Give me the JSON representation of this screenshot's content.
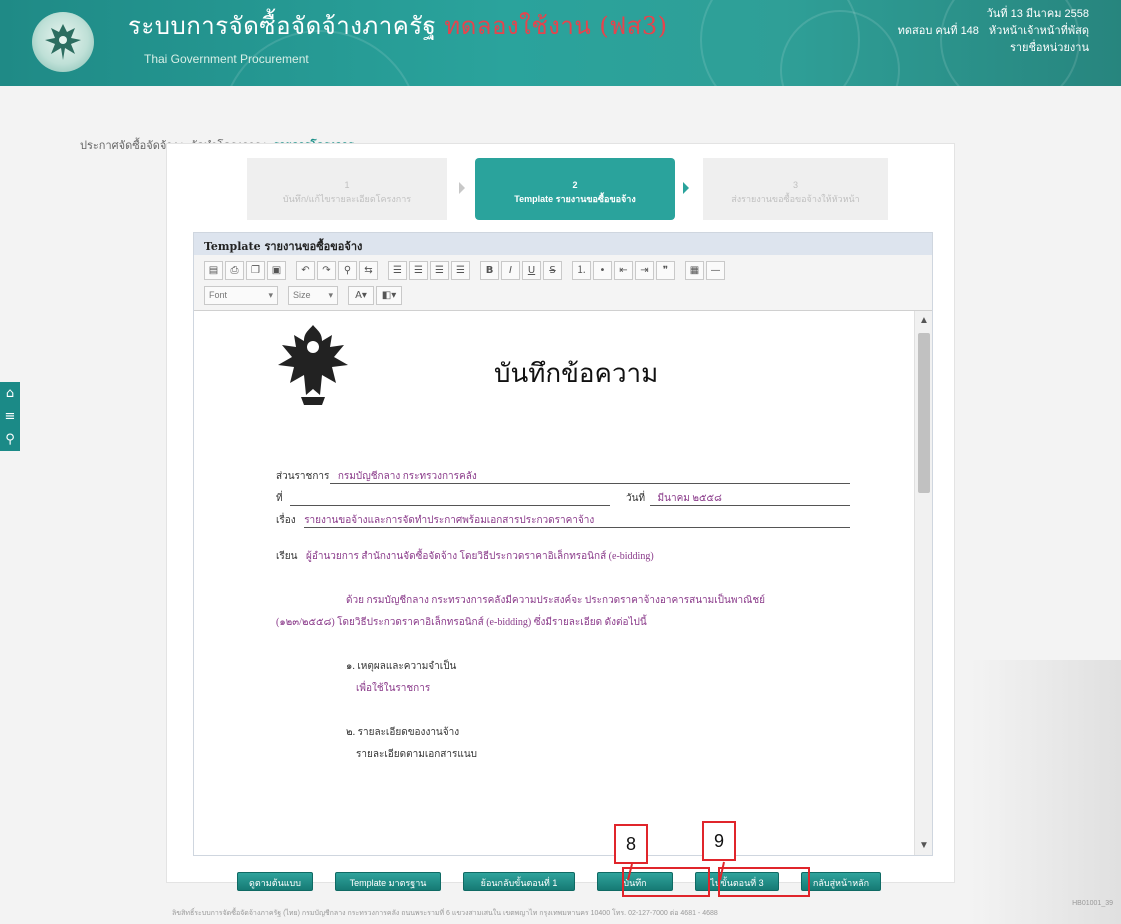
{
  "header": {
    "title": "ระบบการจัดซื้อจัดจ้างภาครัฐ",
    "title_tag": "ทดลองใช้งาน (ฟส3)",
    "subtitle": "Thai Government Procurement",
    "date": "วันที่ 13 มีนาคม 2558",
    "user_label": "ทดสอบ คนที่ 148",
    "role_label": "หัวหน้าเจ้าหน้าที่พัสดุ",
    "org_label": "รายชื่อหน่วยงาน"
  },
  "breadcrumb": {
    "item1": "ประกาศจัดซื้อจัดจ้าง",
    "sep1": ">",
    "item2": "จัดทำโครงการ",
    "sep2": ">",
    "item3": "รายการโครงการ"
  },
  "steps": [
    {
      "num": "1",
      "label": "บันทึก/แก้ไขรายละเอียดโครงการ"
    },
    {
      "num": "2",
      "label": "Template รายงานขอซื้อขอจ้าง"
    },
    {
      "num": "3",
      "label": "ส่งรายงานขอซื้อขอจ้างให้หัวหน้า"
    }
  ],
  "panel": {
    "title": "Template รายงานขอซื้อขอจ้าง"
  },
  "toolbar": {
    "font_label": "Font",
    "size_label": "Size"
  },
  "document": {
    "title": "บันทึกข้อความ",
    "agency_label": "ส่วนราชการ",
    "agency_value": "กรมบัญชีกลาง กระทรวงการคลัง",
    "ref_label": "ที่",
    "date_label": "วันที่",
    "date_value": "มีนาคม ๒๕๕๘",
    "subject_label": "เรื่อง",
    "subject_value": "รายงานขอจ้างและการจัดทำประกาศพร้อมเอกสารประกวดราคาจ้าง",
    "to_label": "เรียน",
    "to_value": "ผู้อำนวยการ สำนักงานจัดซื้อจัดจ้าง โดยวิธีประกวดราคาอิเล็กทรอนิกส์ (e-bidding)",
    "para1_line1": "ด้วย กรมบัญชีกลาง กระทรวงการคลังมีความประสงค์จะ ประกวดราคาจ้างอาคารสนามเป็นพาณิชย์",
    "para1_line2": "(๑๒๓/๒๕๕๘) โดยวิธีประกวดราคาอิเล็กทรอนิกส์ (e-bidding) ซึ่งมีรายละเอียด ดังต่อไปนี้",
    "item1_head": "๑. เหตุผลและความจำเป็น",
    "item1_value": "เพื่อใช้ในราชการ",
    "item2_head": "๒. รายละเอียดของงานจ้าง",
    "item2_value": "รายละเอียดตามเอกสารแนบ"
  },
  "buttons": {
    "b1": "ดูตามต้นแบบ",
    "b2": "Template มาตรฐาน",
    "b3": "ย้อนกลับขั้นตอนที่ 1",
    "b4": "บันทึก",
    "b5": "ไปขั้นตอนที่ 3",
    "b6": "กลับสู่หน้าหลัก"
  },
  "annotations": {
    "n8": "8",
    "n9": "9"
  },
  "footer": {
    "text": "ลิขสิทธิ์ระบบการจัดซื้อจัดจ้างภาครัฐ (ไทย) กรมบัญชีกลาง กระทรวงการคลัง ถนนพระรามที่ 6 แขวงสามเสนใน เขตพญาไท กรุงเทพมหานคร 10400 โทร. 02-127-7000 ต่อ 4681 - 4688",
    "code": "HB01001_39"
  },
  "colors": {
    "brand": "#2aa39c",
    "annotation": "#e0252b",
    "doc_value": "#8a3a8a"
  }
}
